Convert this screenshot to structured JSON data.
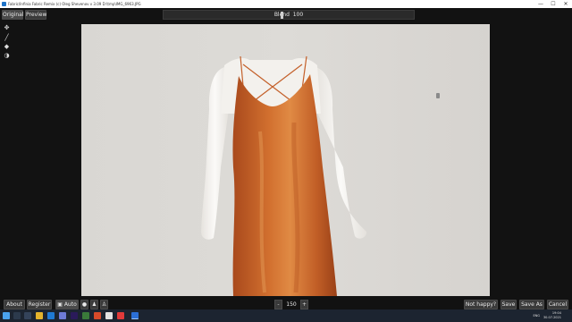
{
  "window": {
    "title": "Fabric/Infinia Fabric Remix (c) Oleg Shevenov v 3.09 D:\\tmp\\IMG_6963.JPG",
    "minimize": "—",
    "maximize": "☐",
    "close": "✕"
  },
  "toolbar": {
    "original_label": "Original",
    "preview_label": "Preview",
    "blend_label": "Blend",
    "blend_value": "100"
  },
  "tools": [
    {
      "name": "move-tool",
      "icon": "move-icon",
      "glyph": "✥"
    },
    {
      "name": "brush-tool",
      "icon": "brush-icon",
      "glyph": "╱"
    },
    {
      "name": "eraser-tool",
      "icon": "eraser-icon",
      "glyph": "◆"
    },
    {
      "name": "contrast-tool",
      "icon": "contrast-icon",
      "glyph": "◑"
    }
  ],
  "bottom": {
    "about_label": "About",
    "register_label": "Register",
    "auto_label": "Auto",
    "zoom_minus": "-",
    "zoom_value": "150",
    "zoom_plus": "+",
    "not_happy_label": "Not happy?",
    "save_label": "Save",
    "save_as_label": "Save As",
    "cancel_label": "Cancel"
  },
  "taskbar": {
    "time": "19:04",
    "date": "30.07.2021",
    "language": "ENG"
  },
  "colors": {
    "dress": "#c8622e",
    "mannequin": "#f4f2ee",
    "backdrop": "#dad8d4"
  }
}
